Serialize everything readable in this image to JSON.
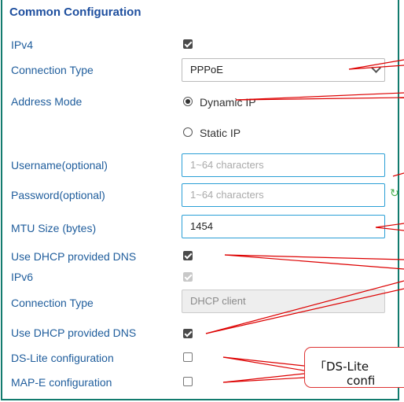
{
  "title": "Common Configuration",
  "ipv4": {
    "label": "IPv4",
    "checked": true,
    "connection_type": {
      "label": "Connection Type",
      "value": "PPPoE"
    },
    "address_mode": {
      "label": "Address Mode",
      "options": [
        "Dynamic IP",
        "Static IP"
      ],
      "selected": "Dynamic IP"
    },
    "username": {
      "label": "Username(optional)",
      "placeholder": "1~64 characters",
      "value": ""
    },
    "password": {
      "label": "Password(optional)",
      "placeholder": "1~64 characters",
      "value": ""
    },
    "mtu": {
      "label": "MTU Size (bytes)",
      "value": "1454"
    },
    "dns": {
      "label": "Use DHCP provided DNS",
      "checked": true
    }
  },
  "ipv6": {
    "label": "IPv6",
    "checked": true,
    "disabled": true,
    "connection_type": {
      "label": "Connection Type",
      "value": "DHCP client"
    },
    "dns": {
      "label": "Use DHCP provided DNS",
      "checked": true
    }
  },
  "dslite": {
    "label": "DS-Lite configuration",
    "checked": false
  },
  "mape": {
    "label": "MAP-E configuration",
    "checked": false
  },
  "callout": {
    "line1": "「DS-Lite",
    "line2": "confi"
  },
  "colors": {
    "label": "#1f5d9c",
    "title": "#1d4e9e",
    "frame": "#127b6e",
    "annotation": "#dd0000"
  }
}
